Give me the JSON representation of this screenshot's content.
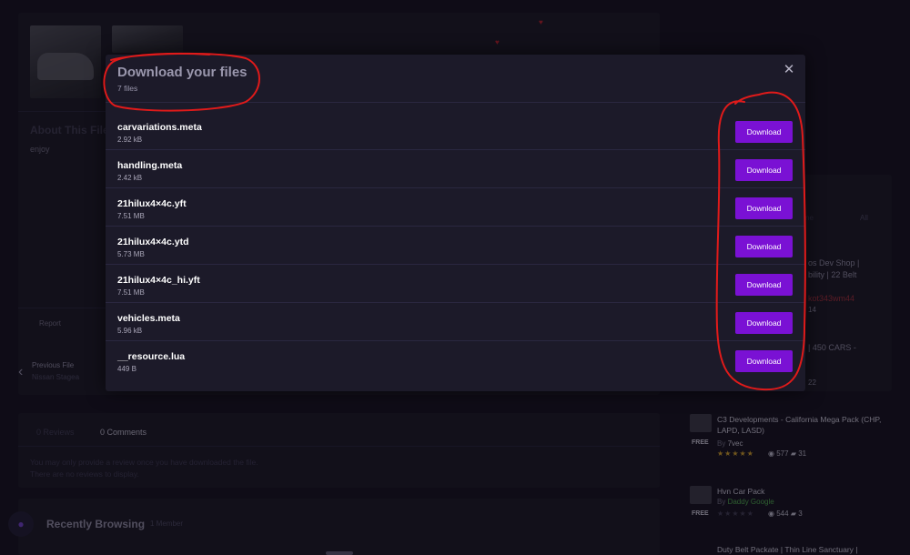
{
  "background": {
    "about": {
      "title": "About This File",
      "text": "enjoy"
    },
    "report_label": "Report",
    "previous_file": {
      "label": "Previous File",
      "name": "Nissan Stagea"
    },
    "reviews": {
      "tabs": [
        "0 Reviews",
        "0 Comments"
      ],
      "notes": [
        "You may only provide a review once you have downloaded the file.",
        "There are no reviews to display."
      ]
    },
    "recently_browsing": {
      "title": "Recently Browsing",
      "count": "1 Member"
    }
  },
  "sidebar": {
    "tab_ne": "ne",
    "tab_all": "All",
    "fragments": {
      "f1": "os Dev Shop |",
      "f2": "bility | 22 Belt",
      "f3": "kot343wm44",
      "f4": "14",
      "f5": "| 450 CARS -",
      "f6": "22"
    },
    "items": [
      {
        "name": "C3 Developments - California Mega Pack (CHP, LAPD, LASD)",
        "price": "FREE",
        "by": "By",
        "author": "7vec",
        "stars": "★★★★★",
        "views": "577",
        "comments": "31"
      },
      {
        "name": "Hvn Car Pack",
        "price": "FREE",
        "by": "By",
        "author": "Daddy Google",
        "stars": "★★★★★",
        "views": "544",
        "comments": "3"
      },
      {
        "name": "Duty Belt Packate | Thin Line Sanctuary |"
      }
    ]
  },
  "modal": {
    "title": "Download your files",
    "subtitle": "7 files",
    "close_glyph": "✕",
    "files": [
      {
        "name": "carvariations.meta",
        "size": "2.92 kB",
        "button": "Download"
      },
      {
        "name": "handling.meta",
        "size": "2.42 kB",
        "button": "Download"
      },
      {
        "name": "21hilux4×4c.yft",
        "size": "7.51 MB",
        "button": "Download"
      },
      {
        "name": "21hilux4×4c.ytd",
        "size": "5.73 MB",
        "button": "Download"
      },
      {
        "name": "21hilux4×4c_hi.yft",
        "size": "7.51 MB",
        "button": "Download"
      },
      {
        "name": "vehicles.meta",
        "size": "5.96 kB",
        "button": "Download"
      },
      {
        "name": "__resource.lua",
        "size": "449 B",
        "button": "Download"
      }
    ]
  },
  "colors": {
    "accent": "#7a11d4",
    "annotation": "#e01a1a",
    "page_bg": "#14121f",
    "modal_bg": "#1c1a29"
  }
}
